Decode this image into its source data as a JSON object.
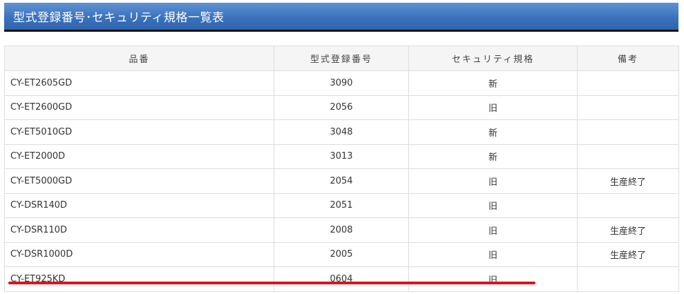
{
  "page": {
    "title": "型式登録番号･セキュリティ規格一覧表"
  },
  "table": {
    "headers": {
      "part": "品番",
      "reg_no": "型式登録番号",
      "security": "セキュリティ規格",
      "note": "備考"
    },
    "rows": [
      {
        "part": "CY-ET2605GD",
        "reg_no": "3090",
        "security": "新",
        "note": ""
      },
      {
        "part": "CY-ET2600GD",
        "reg_no": "2056",
        "security": "旧",
        "note": ""
      },
      {
        "part": "CY-ET5010GD",
        "reg_no": "3048",
        "security": "新",
        "note": ""
      },
      {
        "part": "CY-ET2000D",
        "reg_no": "3013",
        "security": "新",
        "note": ""
      },
      {
        "part": "CY-ET5000GD",
        "reg_no": "2054",
        "security": "旧",
        "note": "生産終了"
      },
      {
        "part": "CY-DSR140D",
        "reg_no": "2051",
        "security": "旧",
        "note": ""
      },
      {
        "part": "CY-DSR110D",
        "reg_no": "2008",
        "security": "旧",
        "note": "生産終了"
      },
      {
        "part": "CY-DSR1000D",
        "reg_no": "2005",
        "security": "旧",
        "note": "生産終了"
      },
      {
        "part": "CY-ET925KD",
        "reg_no": "0604",
        "security": "旧",
        "note": ""
      }
    ]
  },
  "colors": {
    "title_bar": "#3b72bd",
    "underline_annotation": "#e2111f"
  }
}
